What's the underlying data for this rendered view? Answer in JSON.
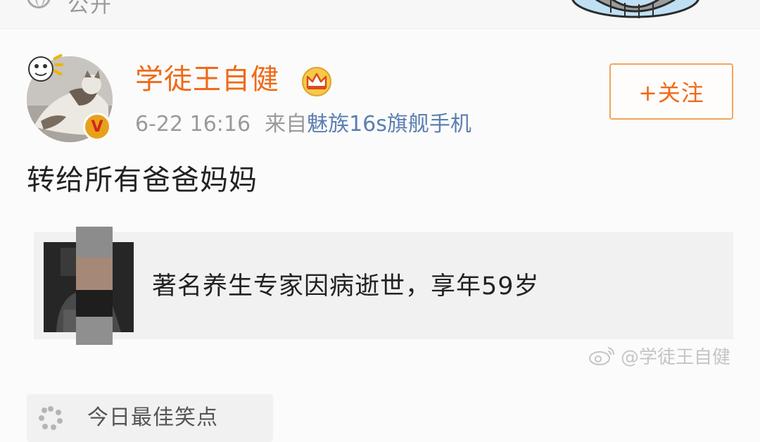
{
  "top": {
    "visibility_label": "公开",
    "icons": {
      "visibility": "globe-icon",
      "illustration": "cartoon-sticker"
    }
  },
  "post": {
    "username": "学徒王自健",
    "username_color": "#f06a17",
    "icons": {
      "crown": "crown-icon",
      "verified": "verified-badge-icon"
    },
    "verified_glyph": "V",
    "date": "6-22 16:16",
    "source_prefix": "来自",
    "source_device": "魅族16s旗舰手机",
    "source_color": "#5b7fb0",
    "follow_button": "+关注",
    "text": "转给所有爸爸妈妈",
    "link_card": {
      "title": "著名养生专家因病逝世，享年59岁"
    },
    "watermark": "@学徒王自健",
    "topic": {
      "label": "今日最佳笑点",
      "icon": "loading-spinner-icon"
    }
  }
}
